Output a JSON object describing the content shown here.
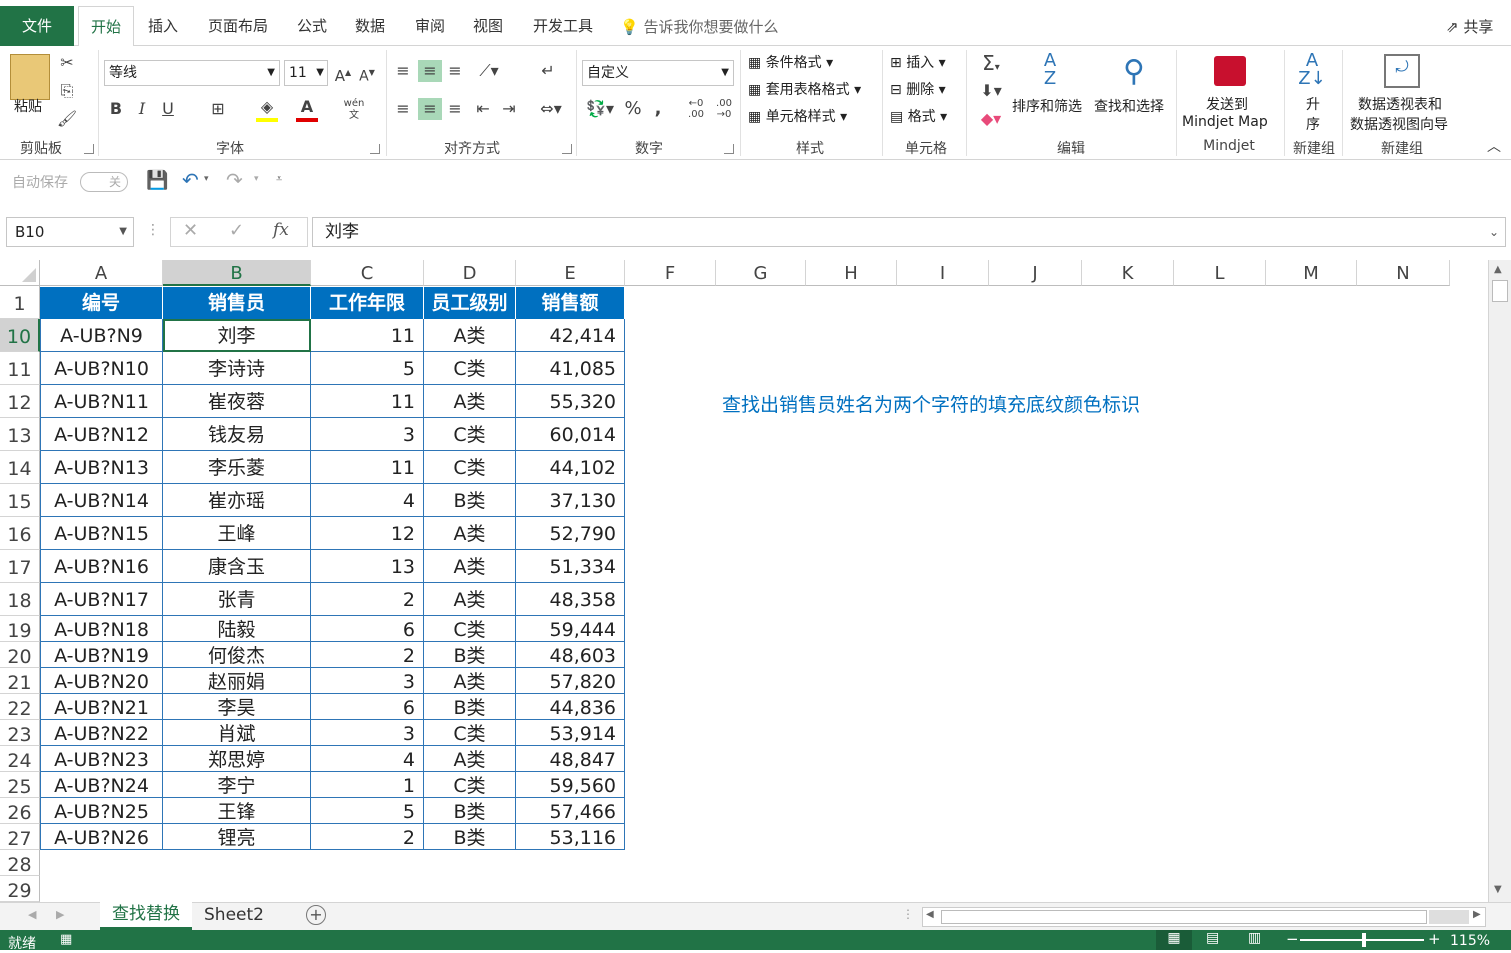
{
  "ribbon_tabs": [
    "文件",
    "开始",
    "插入",
    "页面布局",
    "公式",
    "数据",
    "审阅",
    "视图",
    "开发工具"
  ],
  "tell_me": "告诉我你想要做什么",
  "share": "共享",
  "clipboard": {
    "paste": "粘贴",
    "label": "剪贴板"
  },
  "font": {
    "name": "等线",
    "size": "11",
    "label": "字体",
    "bold": "B",
    "italic": "I",
    "underline": "U",
    "color_a": "A",
    "wen": "wén"
  },
  "alignment": {
    "label": "对齐方式"
  },
  "number": {
    "format": "自定义",
    "label": "数字",
    "percent": "%",
    "comma": ","
  },
  "styles": {
    "cond": "条件格式",
    "table": "套用表格格式",
    "cell": "单元格样式",
    "label": "样式"
  },
  "cells": {
    "insert": "插入",
    "delete": "删除",
    "format": "格式",
    "label": "单元格"
  },
  "editing": {
    "sort": "排序和筛选",
    "find": "查找和选择",
    "label": "编辑",
    "sigma": "Σ"
  },
  "mindjet": {
    "send1": "发送到",
    "send2": "Mindjet Map",
    "label": "Mindjet"
  },
  "newgroup1": {
    "a": "升",
    "b": "序",
    "label": "新建组"
  },
  "newgroup2": {
    "a": "数据透视表和",
    "b": "数据透视图向导",
    "label": "新建组"
  },
  "qat": {
    "autosave": "自动保存",
    "toggle": "关"
  },
  "formula_bar": {
    "name_box": "B10",
    "fx": "fx",
    "value": "刘李"
  },
  "columns": [
    "A",
    "B",
    "C",
    "D",
    "E",
    "F",
    "G",
    "H",
    "I",
    "J",
    "K",
    "L",
    "M",
    "N"
  ],
  "table_header": [
    "编号",
    "销售员",
    "工作年限",
    "员工级别",
    "销售额"
  ],
  "rows": [
    {
      "row": "1"
    },
    {
      "row": "10",
      "id": "A-UB?N9",
      "name": "刘李",
      "years": "11",
      "level": "A类",
      "sales": "42,414"
    },
    {
      "row": "11",
      "id": "A-UB?N10",
      "name": "李诗诗",
      "years": "5",
      "level": "C类",
      "sales": "41,085"
    },
    {
      "row": "12",
      "id": "A-UB?N11",
      "name": "崔夜蓉",
      "years": "11",
      "level": "A类",
      "sales": "55,320"
    },
    {
      "row": "13",
      "id": "A-UB?N12",
      "name": "钱友易",
      "years": "3",
      "level": "C类",
      "sales": "60,014"
    },
    {
      "row": "14",
      "id": "A-UB?N13",
      "name": "李乐菱",
      "years": "11",
      "level": "C类",
      "sales": "44,102"
    },
    {
      "row": "15",
      "id": "A-UB?N14",
      "name": "崔亦瑶",
      "years": "4",
      "level": "B类",
      "sales": "37,130"
    },
    {
      "row": "16",
      "id": "A-UB?N15",
      "name": "王峰",
      "years": "12",
      "level": "A类",
      "sales": "52,790"
    },
    {
      "row": "17",
      "id": "A-UB?N16",
      "name": "康含玉",
      "years": "13",
      "level": "A类",
      "sales": "51,334"
    },
    {
      "row": "18",
      "id": "A-UB?N17",
      "name": "张青",
      "years": "2",
      "level": "A类",
      "sales": "48,358"
    },
    {
      "row": "19",
      "id": "A-UB?N18",
      "name": "陆毅",
      "years": "6",
      "level": "C类",
      "sales": "59,444"
    },
    {
      "row": "20",
      "id": "A-UB?N19",
      "name": "何俊杰",
      "years": "2",
      "level": "B类",
      "sales": "48,603"
    },
    {
      "row": "21",
      "id": "A-UB?N20",
      "name": "赵丽娟",
      "years": "3",
      "level": "A类",
      "sales": "57,820"
    },
    {
      "row": "22",
      "id": "A-UB?N21",
      "name": "李昊",
      "years": "6",
      "level": "B类",
      "sales": "44,836"
    },
    {
      "row": "23",
      "id": "A-UB?N22",
      "name": "肖斌",
      "years": "3",
      "level": "C类",
      "sales": "53,914"
    },
    {
      "row": "24",
      "id": "A-UB?N23",
      "name": "郑思婷",
      "years": "4",
      "level": "A类",
      "sales": "48,847"
    },
    {
      "row": "25",
      "id": "A-UB?N24",
      "name": "李宁",
      "years": "1",
      "level": "C类",
      "sales": "59,560"
    },
    {
      "row": "26",
      "id": "A-UB?N25",
      "name": "王锋",
      "years": "5",
      "level": "B类",
      "sales": "57,466"
    },
    {
      "row": "27",
      "id": "A-UB?N26",
      "name": "锂亮",
      "years": "2",
      "level": "B类",
      "sales": "53,116"
    },
    {
      "row": "28"
    },
    {
      "row": "29"
    }
  ],
  "note": "查找出销售员姓名为两个字符的填充底纹颜色标识",
  "sheets": [
    "查找替换",
    "Sheet2"
  ],
  "status": {
    "ready": "就绪",
    "zoom": "115%"
  },
  "colors": {
    "excel_green": "#217346",
    "header_blue": "#0070c0",
    "note_blue": "#0070c0"
  }
}
